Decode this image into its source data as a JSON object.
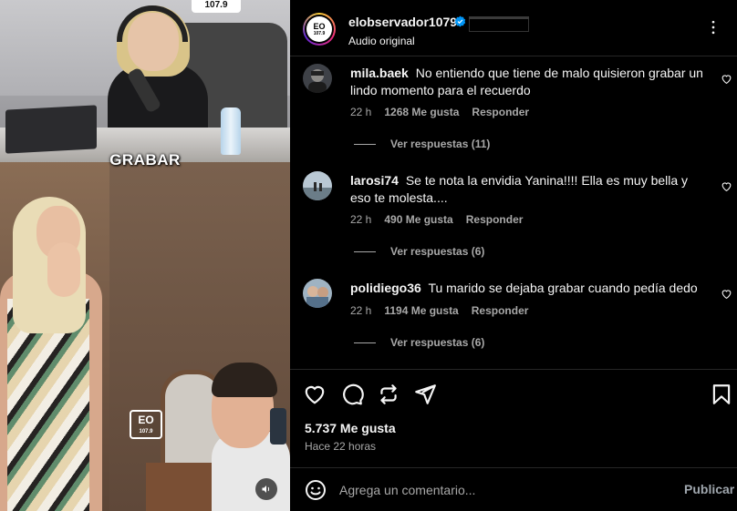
{
  "media": {
    "caption": "GRABAR",
    "top_logo_text": "107.9",
    "watermark_text": "EO",
    "watermark_subtext": "107.9",
    "mute_icon": "speaker-icon"
  },
  "header": {
    "username": "elobservador1079",
    "audio_label": "Audio original",
    "avatar_text": "EO",
    "avatar_subtext": "107.9",
    "verified_color": "#0095f6"
  },
  "comments": [
    {
      "username": "mila.baek",
      "text": "No entiendo que tiene de malo quisieron grabar un lindo momento para el recuerdo",
      "time": "22 h",
      "likes": "1268 Me gusta",
      "reply": "Responder",
      "view_replies": "Ver respuestas (11)"
    },
    {
      "username": "larosi74",
      "text": "Se te nota la envidia Yanina!!!! Ella es muy bella y eso te molesta....",
      "time": "22 h",
      "likes": "490 Me gusta",
      "reply": "Responder",
      "view_replies": "Ver respuestas (6)"
    },
    {
      "username": "polidiego36",
      "text": "Tu marido se dejaba grabar cuando pedía dedo",
      "time": "22 h",
      "likes": "1194 Me gusta",
      "reply": "Responder",
      "view_replies": "Ver respuestas (6)"
    }
  ],
  "post": {
    "likes": "5.737 Me gusta",
    "time_ago": "Hace 22 horas"
  },
  "composer": {
    "placeholder": "Agrega un comentario...",
    "publish_label": "Publicar"
  }
}
